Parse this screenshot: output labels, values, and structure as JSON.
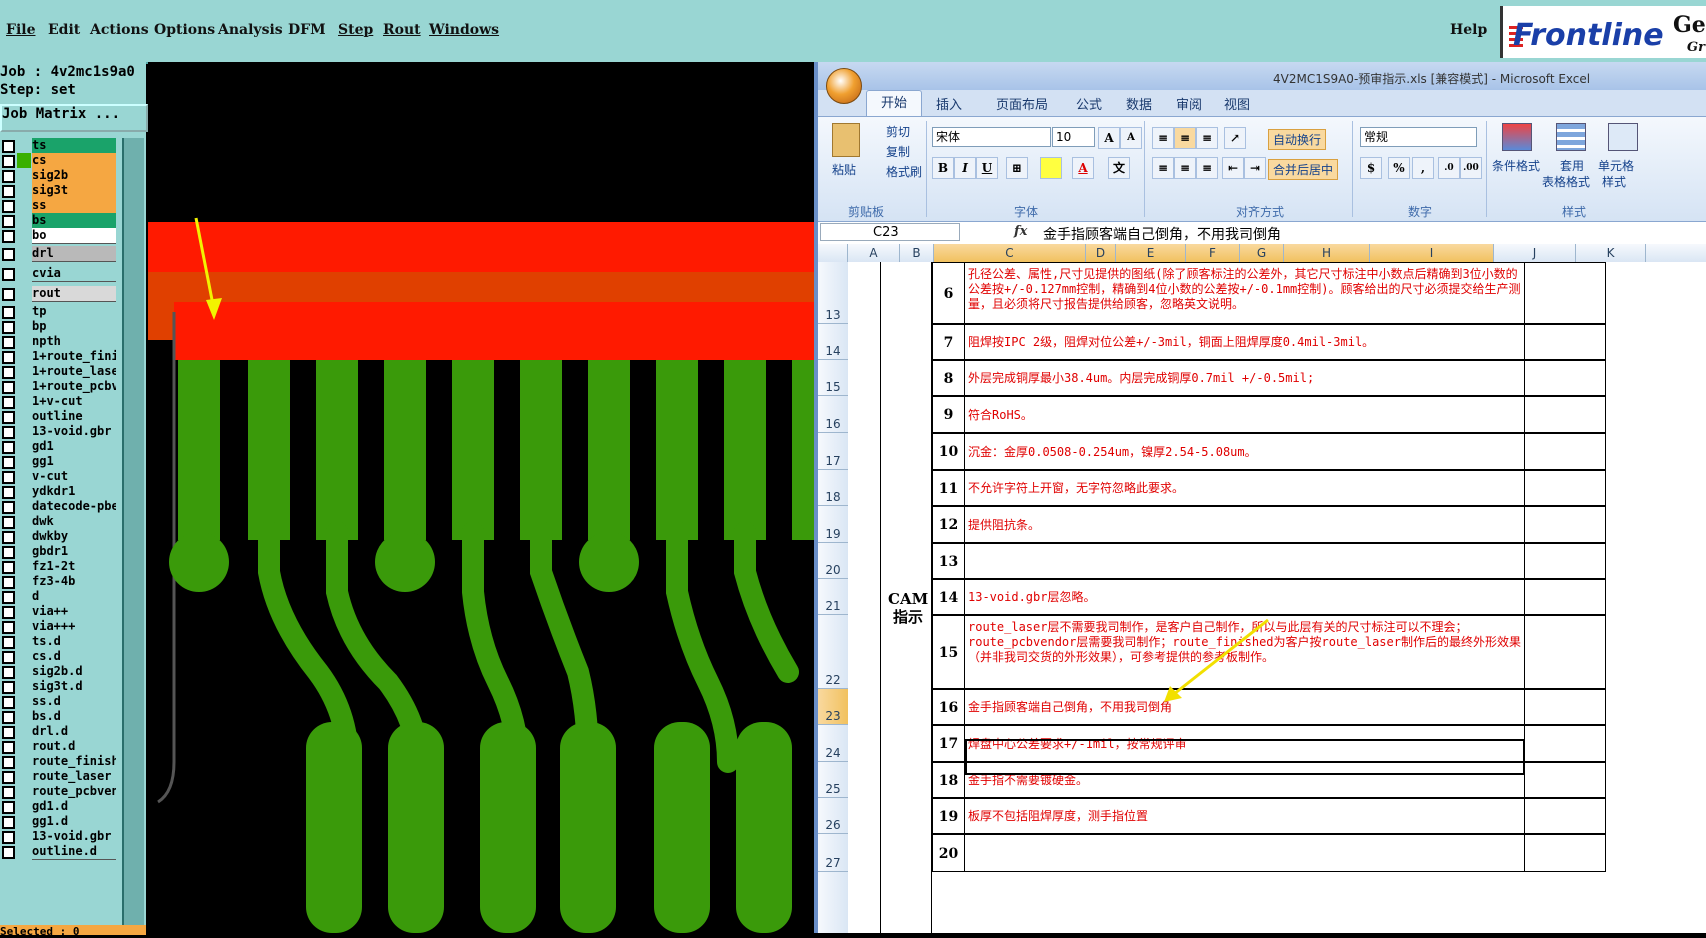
{
  "app": {
    "menu": [
      "File",
      "Edit",
      "Actions",
      "Options",
      "Analysis",
      "DFM",
      "Step",
      "Rout",
      "Windows"
    ],
    "help": "Help",
    "logo_text": "Frontline",
    "logo_gen": "Gen",
    "logo_gr": "Gr"
  },
  "left_panel": {
    "job": "Job : 4v2mc1s9a0",
    "step": "Step: set",
    "job_matrix": "Job Matrix ...",
    "selected": "Selected : 0",
    "layers": [
      {
        "name": "ts",
        "color": "#1aa36a"
      },
      {
        "name": "cs",
        "color": "#f5a742"
      },
      {
        "name": "sig2b",
        "color": "#f5a742"
      },
      {
        "name": "sig3t",
        "color": "#f5a742"
      },
      {
        "name": "ss",
        "color": "#f5a742"
      },
      {
        "name": "bs",
        "color": "#1aa36a"
      },
      {
        "name": "bo",
        "color": "#ffffff"
      },
      {
        "name": "drl",
        "color": "#b9b9b9"
      },
      {
        "name": "cvia",
        "color": "#99d6d3"
      },
      {
        "name": "rout",
        "color": "#d9d9d9"
      },
      {
        "name": "tp",
        "color": "#99d6d3"
      },
      {
        "name": "bp",
        "color": "#99d6d3"
      },
      {
        "name": "npth",
        "color": "#99d6d3"
      },
      {
        "name": "1+route_fini",
        "color": "#99d6d3"
      },
      {
        "name": "1+route_lase",
        "color": "#99d6d3"
      },
      {
        "name": "1+route_pcbv",
        "color": "#99d6d3"
      },
      {
        "name": "1+v-cut",
        "color": "#99d6d3"
      },
      {
        "name": "outline",
        "color": "#99d6d3"
      },
      {
        "name": "13-void.gbr",
        "color": "#99d6d3"
      },
      {
        "name": "gd1",
        "color": "#99d6d3"
      },
      {
        "name": "gg1",
        "color": "#99d6d3"
      },
      {
        "name": "v-cut",
        "color": "#99d6d3"
      },
      {
        "name": "ydkdr1",
        "color": "#99d6d3"
      },
      {
        "name": "datecode-pbe",
        "color": "#99d6d3"
      },
      {
        "name": "dwk",
        "color": "#99d6d3"
      },
      {
        "name": "dwkby",
        "color": "#99d6d3"
      },
      {
        "name": "gbdr1",
        "color": "#99d6d3"
      },
      {
        "name": "fz1-2t",
        "color": "#99d6d3"
      },
      {
        "name": "fz3-4b",
        "color": "#99d6d3"
      },
      {
        "name": "d",
        "color": "#99d6d3"
      },
      {
        "name": "via++",
        "color": "#99d6d3"
      },
      {
        "name": "via+++",
        "color": "#99d6d3"
      },
      {
        "name": "ts.d",
        "color": "#99d6d3"
      },
      {
        "name": "cs.d",
        "color": "#99d6d3"
      },
      {
        "name": "sig2b.d",
        "color": "#99d6d3"
      },
      {
        "name": "sig3t.d",
        "color": "#99d6d3"
      },
      {
        "name": "ss.d",
        "color": "#99d6d3"
      },
      {
        "name": "bs.d",
        "color": "#99d6d3"
      },
      {
        "name": "drl.d",
        "color": "#99d6d3"
      },
      {
        "name": "rout.d",
        "color": "#99d6d3"
      },
      {
        "name": "route_finish",
        "color": "#99d6d3"
      },
      {
        "name": "route_laser",
        "color": "#99d6d3"
      },
      {
        "name": "route_pcbven",
        "color": "#99d6d3"
      },
      {
        "name": "gd1.d",
        "color": "#99d6d3"
      },
      {
        "name": "gg1.d",
        "color": "#99d6d3"
      },
      {
        "name": "13-void.gbr",
        "color": "#99d6d3"
      },
      {
        "name": "outline.d",
        "color": "#99d6d3"
      }
    ]
  },
  "excel": {
    "title": "4V2MC1S9A0-预审指示.xls [兼容模式] - Microsoft Excel",
    "tabs": [
      "开始",
      "插入",
      "页面布局",
      "公式",
      "数据",
      "审阅",
      "视图"
    ],
    "ribbon": {
      "paste": "粘贴",
      "cut": "剪切",
      "copy": "复制",
      "format_painter": "格式刷",
      "clipboard": "剪贴板",
      "font_name": "宋体",
      "font_size": "10",
      "font_group": "字体",
      "wrap_text": "自动换行",
      "merge_center": "合并后居中",
      "align_group": "对齐方式",
      "number_format": "常规",
      "number_group": "数字",
      "cond_format": "条件格式",
      "table_format_1": "套用",
      "table_format_2": "表格格式",
      "cell_style_1": "单元格",
      "cell_style_2": "样式",
      "styles_group": "样式"
    },
    "name_box": "C23",
    "formula": "金手指顾客端自己倒角，不用我司倒角",
    "columns": [
      "A",
      "B",
      "C",
      "D",
      "E",
      "F",
      "G",
      "H",
      "I",
      "J",
      "K"
    ],
    "cam_label": "CAM 指示",
    "rows": [
      {
        "row": "13",
        "num": "6",
        "text": "孔径公差、属性,尺寸见提供的图纸(除了顾客标注的公差外，其它尺寸标注中小数点后精确到3位小数的公差按+/-0.127mm控制，精确到4位小数的公差按+/-0.1mm控制)。顾客给出的尺寸必须提交给生产测量，且必须将尺寸报告提供给顾客，忽略英文说明。"
      },
      {
        "row": "14",
        "num": "7",
        "text": "阻焊按IPC 2级，阻焊对位公差+/-3mil，铜面上阻焊厚度0.4mil-3mil。"
      },
      {
        "row": "15",
        "num": "8",
        "text": "外层完成铜厚最小38.4um。内层完成铜厚0.7mil +/-0.5mil;"
      },
      {
        "row": "16",
        "num": "9",
        "text": "符合RoHS。"
      },
      {
        "row": "17",
        "num": "10",
        "text": "沉金：金厚0.0508-0.254um，镍厚2.54-5.08um。"
      },
      {
        "row": "18",
        "num": "11",
        "text": "不允许字符上开窗，无字符忽略此要求。"
      },
      {
        "row": "19",
        "num": "12",
        "text": "提供阻抗条。"
      },
      {
        "row": "20",
        "num": "13",
        "text": ""
      },
      {
        "row": "21",
        "num": "14",
        "text": "13-void.gbr层忽略。"
      },
      {
        "row": "22",
        "num": "15",
        "text": "route_laser层不需要我司制作，是客户自己制作，所以与此层有关的尺寸标注可以不理会；route_pcbvendor层需要我司制作；route_finished为客户按route_laser制作后的最终外形效果（并非我司交货的外形效果），可参考提供的参考板制作。"
      },
      {
        "row": "23",
        "num": "16",
        "text": "金手指顾客端自己倒角，不用我司倒角"
      },
      {
        "row": "24",
        "num": "17",
        "text": "焊盘中心公差要求+/-1mil，按常规评审"
      },
      {
        "row": "25",
        "num": "18",
        "text": "金手指不需要镀硬金。"
      },
      {
        "row": "26",
        "num": "19",
        "text": "板厚不包括阻焊厚度，测手指位置"
      },
      {
        "row": "27",
        "num": "20",
        "text": ""
      }
    ]
  }
}
